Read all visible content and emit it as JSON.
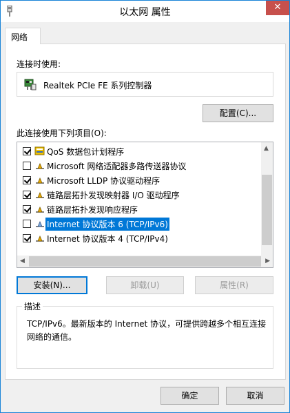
{
  "window": {
    "title": "以太网 属性",
    "close_glyph": "✕"
  },
  "tabs": [
    {
      "label": "网络"
    }
  ],
  "connect_using": {
    "label": "连接时使用:",
    "adapter_name": "Realtek PCIe FE 系列控制器",
    "configure_label": "配置(C)..."
  },
  "items_section": {
    "label": "此连接使用下列项目(O):"
  },
  "items": [
    {
      "label": "QoS 数据包计划程序",
      "checked": true,
      "icon": "qos-icon"
    },
    {
      "label": "Microsoft 网络适配器多路传送器协议",
      "checked": false,
      "icon": "protocol-icon"
    },
    {
      "label": "Microsoft LLDP 协议驱动程序",
      "checked": true,
      "icon": "protocol-icon"
    },
    {
      "label": "链路层拓扑发现映射器 I/O 驱动程序",
      "checked": true,
      "icon": "protocol-icon"
    },
    {
      "label": "链路层拓扑发现响应程序",
      "checked": true,
      "icon": "protocol-icon"
    },
    {
      "label": "Internet 协议版本 6 (TCP/IPv6)",
      "checked": false,
      "icon": "protocol-icon",
      "selected": true
    },
    {
      "label": "Internet 协议版本 4 (TCP/IPv4)",
      "checked": true,
      "icon": "protocol-icon"
    }
  ],
  "item_buttons": {
    "install": "安装(N)...",
    "uninstall": "卸载(U)",
    "properties": "属性(R)"
  },
  "description": {
    "title": "描述",
    "text": "TCP/IPv6。最新版本的 Internet 协议，可提供跨越多个相互连接网络的通信。"
  },
  "footer": {
    "ok": "确定",
    "cancel": "取消"
  },
  "colors": {
    "accent": "#0078d7",
    "close": "#c7504c"
  }
}
